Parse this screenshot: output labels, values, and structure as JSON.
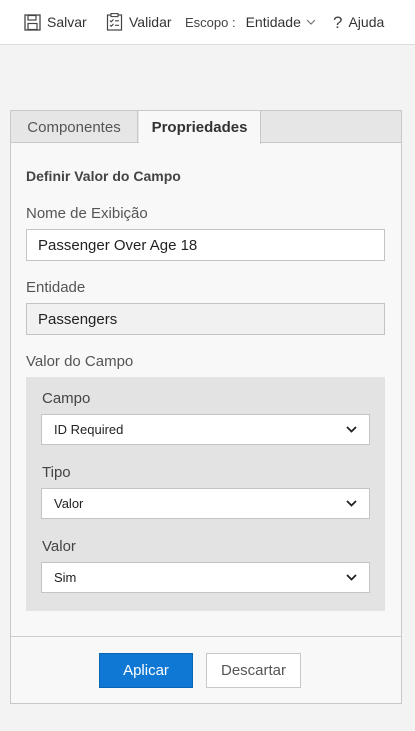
{
  "toolbar": {
    "save_label": "Salvar",
    "validate_label": "Validar",
    "scope_label": "Escopo :",
    "scope_value": "Entidade",
    "help_label": "Ajuda"
  },
  "tabs": [
    {
      "label": "Componentes",
      "active": false
    },
    {
      "label": "Propriedades",
      "active": true
    }
  ],
  "properties": {
    "section_title": "Definir Valor do Campo",
    "display_name": {
      "label": "Nome de Exibição",
      "value": "Passenger Over Age 18"
    },
    "entity": {
      "label": "Entidade",
      "value": "Passengers"
    },
    "field_value_group": {
      "label": "Valor do Campo",
      "field": {
        "label": "Campo",
        "selected": "ID Required"
      },
      "type": {
        "label": "Tipo",
        "selected": "Valor"
      },
      "value": {
        "label": "Valor",
        "selected": "Sim"
      }
    }
  },
  "actions": {
    "apply_label": "Aplicar",
    "discard_label": "Descartar"
  },
  "colors": {
    "primary_button": "#0f78d4",
    "group_background": "#e3e3e3",
    "tab_bar": "#e6e6e6"
  }
}
